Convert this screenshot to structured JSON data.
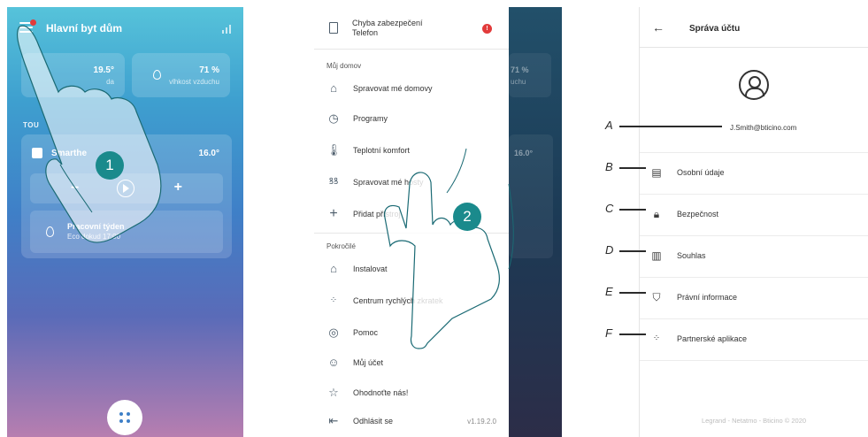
{
  "screen1": {
    "title": "Hlavní byt dům",
    "temp_value": "19.5°",
    "temp_label": "da",
    "humidity_value": "71 %",
    "humidity_label": "vlhkost vzduchu",
    "section_label": "TOU",
    "thermostat_name": "Smarthe",
    "thermostat_temp": "16.0°",
    "minus": "−",
    "plus": "+",
    "schedule_title": "Pracovní týden",
    "schedule_subtitle": "Eco dokud 17:00",
    "step": "1"
  },
  "screen2": {
    "ghost_humidity": "71 %",
    "ghost_humidity_label": "uchu",
    "ghost_temp": "16.0°",
    "alert_title_1": "Chyba zabezpečení",
    "alert_title_2": "Telefon",
    "alert_badge": "!",
    "section_home": "Můj domov",
    "section_advanced": "Pokročilé",
    "menu_home": [
      {
        "icon": "house-icon",
        "label": "Spravovat mé domovy"
      },
      {
        "icon": "clock-icon",
        "label": "Programy"
      },
      {
        "icon": "thermometer-icon",
        "label": "Teplotní komfort"
      },
      {
        "icon": "guests-icon",
        "label": "Spravovat mé hosty"
      },
      {
        "icon": "plus-icon",
        "label": "Přidat přístroj"
      }
    ],
    "menu_advanced": [
      {
        "icon": "install-icon",
        "label": "Instalovat"
      },
      {
        "icon": "shortcuts-icon",
        "label": "Centrum rychlých zkratek"
      },
      {
        "icon": "help-icon",
        "label": "Pomoc"
      },
      {
        "icon": "account-icon",
        "label": "Můj účet"
      },
      {
        "icon": "star-icon",
        "label": "Ohodnoťte nás!"
      },
      {
        "icon": "logout-icon",
        "label": "Odhlásit se"
      }
    ],
    "version": "v1.19.2.0",
    "step": "2"
  },
  "screen3": {
    "title": "Správa účtu",
    "back": "←",
    "email": "J.Smith@bticino.com",
    "rows": [
      {
        "icon": "id-card-icon",
        "label": "Osobní údaje",
        "callout": "B"
      },
      {
        "icon": "lock-icon",
        "label": "Bezpečnost",
        "callout": "C"
      },
      {
        "icon": "consent-icon",
        "label": "Souhlas",
        "callout": "D"
      },
      {
        "icon": "shield-icon",
        "label": "Právní informace",
        "callout": "E"
      },
      {
        "icon": "partner-apps-icon",
        "label": "Partnerské aplikace",
        "callout": "F"
      }
    ],
    "email_callout": "A",
    "footer": "Legrand - Netatmo - Bticino © 2020"
  }
}
